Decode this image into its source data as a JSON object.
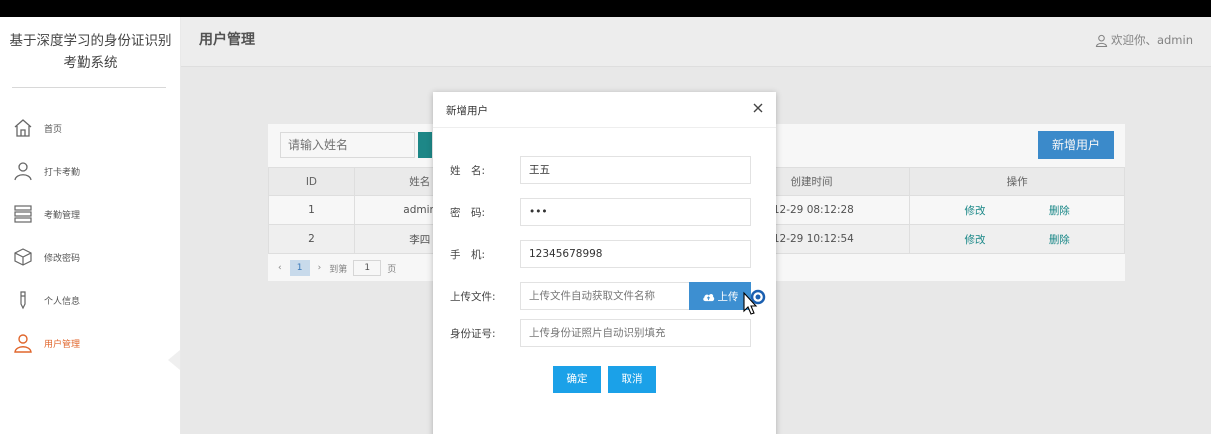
{
  "sidebar": {
    "brand_line1": "基于深度学习的身份证识别",
    "brand_line2": "考勤系统",
    "items": [
      {
        "label": "首页",
        "icon": "home-icon"
      },
      {
        "label": "打卡考勤",
        "icon": "user-icon"
      },
      {
        "label": "考勤管理",
        "icon": "list-icon"
      },
      {
        "label": "修改密码",
        "icon": "box-icon"
      },
      {
        "label": "个人信息",
        "icon": "pen-icon"
      },
      {
        "label": "用户管理",
        "icon": "user-icon",
        "active": true
      }
    ]
  },
  "header": {
    "title": "用户管理",
    "welcome": "欢迎你、admin"
  },
  "toolbar": {
    "search_placeholder": "请输入姓名",
    "add_label": "新增用户"
  },
  "table": {
    "columns": [
      "ID",
      "姓名",
      "创建时间",
      "操作"
    ],
    "rows": [
      {
        "id": "1",
        "name": "admin",
        "created": "-12-29 08:12:28",
        "edit": "修改",
        "delete": "删除"
      },
      {
        "id": "2",
        "name": "李四",
        "created": "-12-29 10:12:54",
        "edit": "修改",
        "delete": "删除"
      }
    ]
  },
  "pager": {
    "current": "1",
    "goto_label": "到第",
    "goto_value": "1",
    "page_label": "页"
  },
  "modal": {
    "title": "新增用户",
    "name_label": "姓　名:",
    "name_value": "王五",
    "password_label": "密　码:",
    "password_value": "•••",
    "phone_label": "手　机:",
    "phone_value": "12345678998",
    "file_label": "上传文件:",
    "file_placeholder": "上传文件自动获取文件名称",
    "upload_label": "上传",
    "idcard_label": "身份证号:",
    "idcard_placeholder": "上传身份证照片自动识别填充",
    "ok_label": "确定",
    "cancel_label": "取消"
  },
  "colors": {
    "accent": "#3d8fd1",
    "active_nav": "#e0662c",
    "link": "#1a8c8c",
    "confirm": "#1ba1e8"
  }
}
